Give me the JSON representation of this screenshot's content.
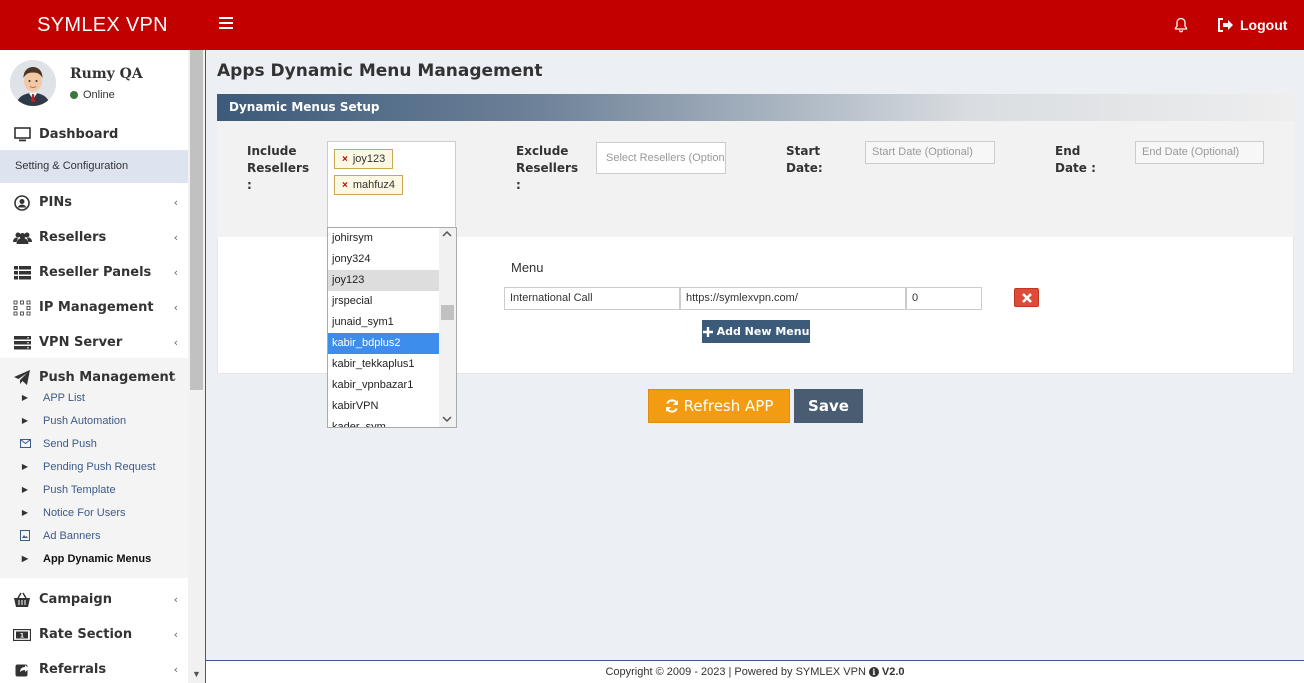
{
  "header": {
    "brand": "SYMLEX VPN",
    "logout_label": "Logout"
  },
  "user": {
    "name": "Rumy QA",
    "status": "Online"
  },
  "sidebar": {
    "dashboard": "Dashboard",
    "section_label": "Setting & Configuration",
    "items": [
      {
        "label": "PINs",
        "icon": "user-circle-icon"
      },
      {
        "label": "Resellers",
        "icon": "users-icon"
      },
      {
        "label": "Reseller Panels",
        "icon": "list-icon"
      },
      {
        "label": "IP Management",
        "icon": "sitemap-icon"
      },
      {
        "label": "VPN Server",
        "icon": "server-icon"
      },
      {
        "label": "Push Management",
        "icon": "paper-plane-icon"
      }
    ],
    "push_sub": [
      {
        "label": "APP List",
        "icon": "caret-right-icon"
      },
      {
        "label": "Push Automation",
        "icon": "caret-right-icon"
      },
      {
        "label": "Send Push",
        "icon": "envelope-icon"
      },
      {
        "label": "Pending Push Request",
        "icon": "caret-right-icon"
      },
      {
        "label": "Push Template",
        "icon": "caret-right-icon"
      },
      {
        "label": "Notice For Users",
        "icon": "caret-right-icon"
      },
      {
        "label": "Ad Banners",
        "icon": "image-icon"
      },
      {
        "label": "App Dynamic Menus",
        "icon": "caret-right-icon"
      }
    ],
    "bottom_items": [
      {
        "label": "Campaign",
        "icon": "basket-icon"
      },
      {
        "label": "Rate Section",
        "icon": "money-icon"
      },
      {
        "label": "Referrals",
        "icon": "share-icon"
      }
    ]
  },
  "page": {
    "title": "Apps Dynamic Menu Management",
    "panel_title": "Dynamic Menus Setup"
  },
  "form": {
    "include_label_1": "Include",
    "include_label_2": "Resellers",
    "include_label_3": ":",
    "include_tags": [
      "joy123",
      "mahfuz4"
    ],
    "exclude_label_1": "Exclude",
    "exclude_label_2": "Resellers",
    "exclude_label_3": ":",
    "exclude_placeholder": "Select Resellers (Optional)",
    "start_label_1": "Start",
    "start_label_2": "Date:",
    "start_placeholder": "Start Date  (Optional)",
    "end_label_1": "End",
    "end_label_2": "Date :",
    "end_placeholder": "End Date (Optional)"
  },
  "dropdown": {
    "options": [
      "johirsym",
      "jony324",
      "joy123",
      "jrspecial",
      "junaid_sym1",
      "kabir_bdplus2",
      "kabir_tekkaplus1",
      "kabir_vpnbazar1",
      "kabirVPN",
      "kader_sym"
    ],
    "highlighted": "joy123",
    "selected": "kabir_bdplus2"
  },
  "menu": {
    "heading": "Menu",
    "rows": [
      {
        "name": "International Call",
        "url": "https://symlexvpn.com/",
        "order": "0"
      }
    ],
    "add_label": "Add New Menu"
  },
  "actions": {
    "refresh_label": "Refresh APP",
    "save_label": "Save"
  },
  "footer": {
    "text": "Copyright © 2009 - 2023 | Powered by SYMLEX VPN",
    "version": "V2.0"
  },
  "colors": {
    "header": "#c30000",
    "accent": "#3c5a7a",
    "refresh": "#f39c12",
    "delete": "#dd4b39",
    "selected_option": "#3d8eec"
  }
}
